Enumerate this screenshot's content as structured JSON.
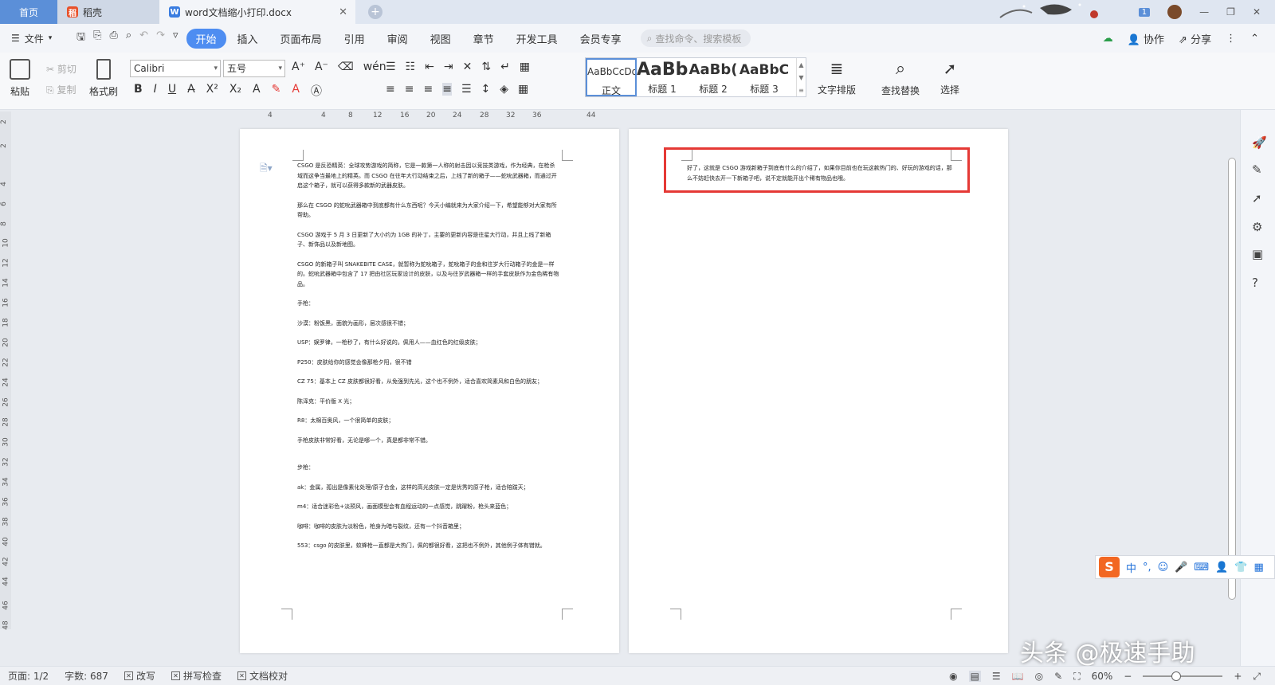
{
  "tabs": {
    "home": "首页",
    "daoke": "稻壳",
    "doc": "word文档缩小打印.docx"
  },
  "titlebar": {
    "badge": "1"
  },
  "menu": {
    "file": "文件",
    "items": [
      "开始",
      "插入",
      "页面布局",
      "引用",
      "审阅",
      "视图",
      "章节",
      "开发工具",
      "会员专享"
    ],
    "search_placeholder": "查找命令、搜索模板",
    "collab": "协作",
    "share": "分享"
  },
  "ribbon": {
    "paste": "粘贴",
    "cut": "剪切",
    "copy": "复制",
    "format_painter": "格式刷",
    "font_name": "Calibri",
    "font_size": "五号",
    "styles": [
      {
        "sample": "AaBbCcDd",
        "name": "正文"
      },
      {
        "sample": "AaBb",
        "name": "标题 1"
      },
      {
        "sample": "AaBb(",
        "name": "标题 2"
      },
      {
        "sample": "AaBbC",
        "name": "标题 3"
      }
    ],
    "text_layout": "文字排版",
    "find_replace": "查找替换",
    "select": "选择"
  },
  "ruler": {
    "h_ticks": [
      "4",
      "4",
      "8",
      "12",
      "16",
      "20",
      "24",
      "28",
      "32",
      "36",
      "44"
    ],
    "v_ticks": [
      "2",
      "2",
      "4",
      "6",
      "8",
      "10",
      "12",
      "14",
      "16",
      "18",
      "20",
      "22",
      "24",
      "26",
      "28",
      "30",
      "32",
      "34",
      "36",
      "38",
      "40",
      "42",
      "44",
      "46",
      "48"
    ]
  },
  "page1": {
    "paragraphs": [
      "CSGO 是反恐精英：全球攻势游戏的简称，它是一款第一人称的射击因以竞技类游戏，作为经典，在枪杀域而这争当最地上的精英。而 CSGO 在往年大行动结束之后，上线了新的箱子——蛇吮武器箱，而通过开启这个箱子，就可以获得多款新的武器皮肤。",
      "那么在 CSGO 的蛇吮武器箱中到底都有什么东西呢？今天小编就来为大家介绍一下，希望能够对大家有所帮助。",
      "CSGO 游戏于 5 月 3 日更新了大小约为 1GB 的补丁，主要的更新内容是往星大行动，并且上线了新箱子、新饰品以及新地图。",
      "CSGO 的新箱子叫 SNAKEBITE CASE，就暂称为蛇吮箱子，蛇吮箱子的金和往岁大行动箱子的金是一样的。蛇吮武器箱中包含了 17 把由社区玩家设计的皮肤，以及与往岁武器箱一样的手套皮肤作为金色稀有物品。",
      "手枪：",
      "沙漠：粉饭黑，面貌为画形，层次感很不错；",
      "USP：娱罗律，一枪秒了，有什么好说的。佩用人——血红色的红级皮肤；",
      "P250：皮肤给你的感觉会像那枪夕阳，很不错",
      "CZ 75：基本上 CZ 皮肤都很好看，从免强到先光，这个也不例外，适合喜欢简素风和白色的朋友；",
      "陈泽克：平价版 X 光；",
      "R8：太棉百奥风，一个很简单的皮肤；",
      "手枪皮肤非常好看，无论是哪一个，真是都非常不错。",
      "步枪：",
      "ak：金属，孤出是像素化处理/原子合金，这样的高光皮肤一定是优秀的原子枪，适合陪跋天；",
      "m4：适合迷彩色+淡预风，画面模型会有血程运动的一点感觉，跳躍粉，枪头来蓝色；",
      "咖啡：咖啡的皮肤为淡粉色，枪身为暗与裂纹，还有一个抖音箱里；",
      "553：csgo 的皮肤里，蚊蜂枪一直都是大热门，佩的都很好看，这把也不例外，其他例子体有错就。"
    ]
  },
  "page2": {
    "text": "好了，这就是 CSGO 游戏新箱子到底有什么的介绍了，如果你目前也在玩这款热门的、好玩的游戏的话，那么不妨赶快去开一下新箱子吧，说不定就能开出个稀有物品也哦。"
  },
  "ime": {
    "logo": "S",
    "mode": "中"
  },
  "watermark": "头条 @极速手助",
  "status": {
    "page": "页面: 1/2",
    "words": "字数: 687",
    "revise": "改写",
    "spell": "拼写检查",
    "proof": "文档校对",
    "zoom": "60%"
  },
  "colors": {
    "accent": "#4e8df1",
    "home_tab": "#5b8fd8",
    "highlight_box": "#e53935"
  }
}
